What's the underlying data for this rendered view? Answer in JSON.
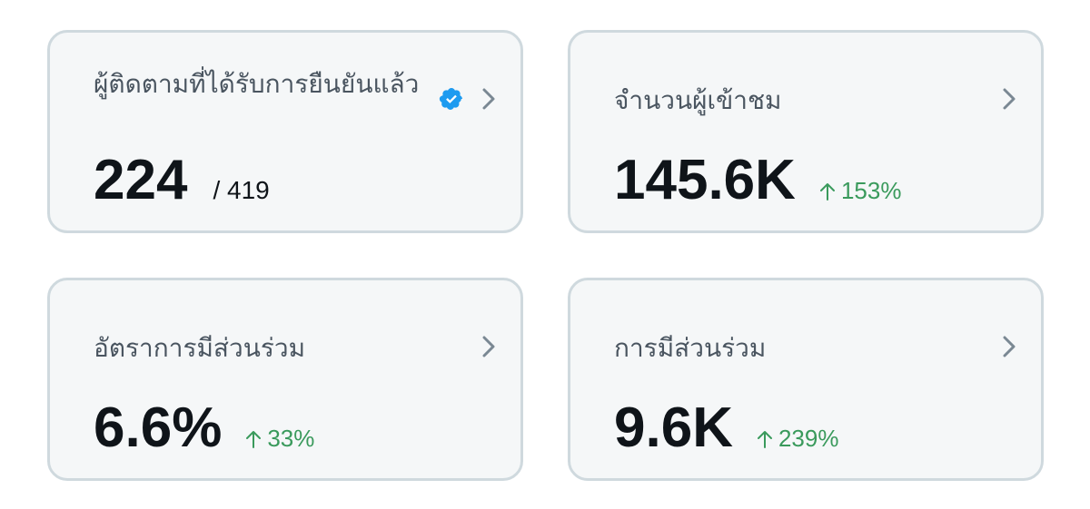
{
  "cards": [
    {
      "title": "ผู้ติดตามที่ได้รับการยืนยันแล้ว",
      "value": "224",
      "total": "/ 419",
      "verified_icon": "verified-badge-icon",
      "chevron_icon": "chevron-right-icon"
    },
    {
      "title": "จำนวนผู้เข้าชม",
      "value": "145.6K",
      "change": "153%",
      "trend_icon": "arrow-up-icon",
      "chevron_icon": "chevron-right-icon"
    },
    {
      "title": "อัตราการมีส่วนร่วม",
      "value": "6.6%",
      "change": "33%",
      "trend_icon": "arrow-up-icon",
      "chevron_icon": "chevron-right-icon"
    },
    {
      "title": "การมีส่วนร่วม",
      "value": "9.6K",
      "change": "239%",
      "trend_icon": "arrow-up-icon",
      "chevron_icon": "chevron-right-icon"
    }
  ],
  "colors": {
    "card_background": "#f5f7f8",
    "card_border": "#cfd9de",
    "title_text": "#4a5560",
    "value_text": "#0f1419",
    "positive_change": "#3a9a5c",
    "verified_badge": "#1d9bf0",
    "chevron": "#7a8893"
  }
}
